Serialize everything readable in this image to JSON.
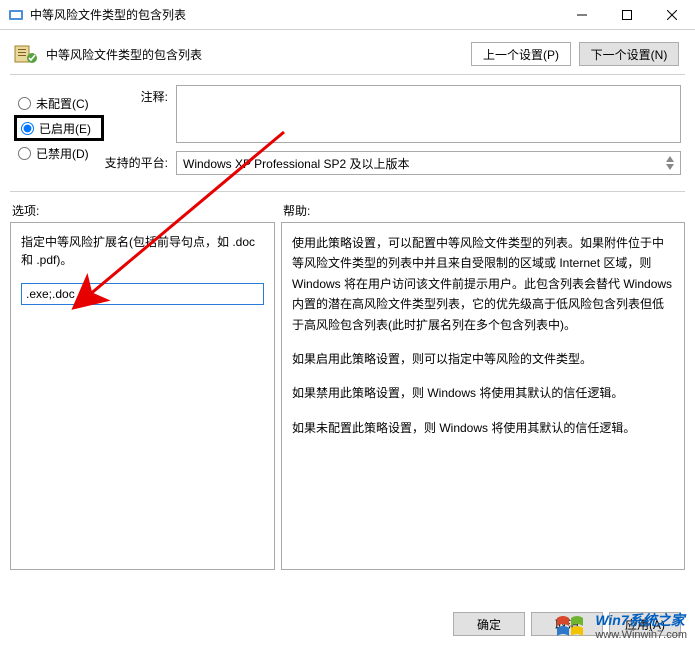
{
  "window": {
    "title": "中等风险文件类型的包含列表"
  },
  "header": {
    "title": "中等风险文件类型的包含列表",
    "prev_btn": "上一个设置(P)",
    "next_btn": "下一个设置(N)"
  },
  "radios": {
    "not_configured": "未配置(C)",
    "enabled": "已启用(E)",
    "disabled": "已禁用(D)"
  },
  "fields": {
    "comment_label": "注释:",
    "platform_label": "支持的平台:",
    "platform_value": "Windows XP Professional SP2 及以上版本"
  },
  "columns": {
    "options_label": "选项:",
    "help_label": "帮助:"
  },
  "options": {
    "desc": "指定中等风险扩展名(包括前导句点，如 .doc 和 .pdf)。",
    "input_value": ".exe;.doc"
  },
  "help": {
    "p1": "使用此策略设置，可以配置中等风险文件类型的列表。如果附件位于中等风险文件类型的列表中并且来自受限制的区域或 Internet 区域，则 Windows 将在用户访问该文件前提示用户。此包含列表会替代 Windows 内置的潜在高风险文件类型列表，它的优先级高于低风险包含列表但低于高风险包含列表(此时扩展名列在多个包含列表中)。",
    "p2": "如果启用此策略设置，则可以指定中等风险的文件类型。",
    "p3": "如果禁用此策略设置，则 Windows 将使用其默认的信任逻辑。",
    "p4": "如果未配置此策略设置，则 Windows 将使用其默认的信任逻辑。"
  },
  "footer": {
    "ok": "确定",
    "cancel": "取消",
    "apply": "应用(A)"
  },
  "watermark": {
    "line1": "Win7系统之家",
    "line2": "www.Winwin7.com"
  }
}
